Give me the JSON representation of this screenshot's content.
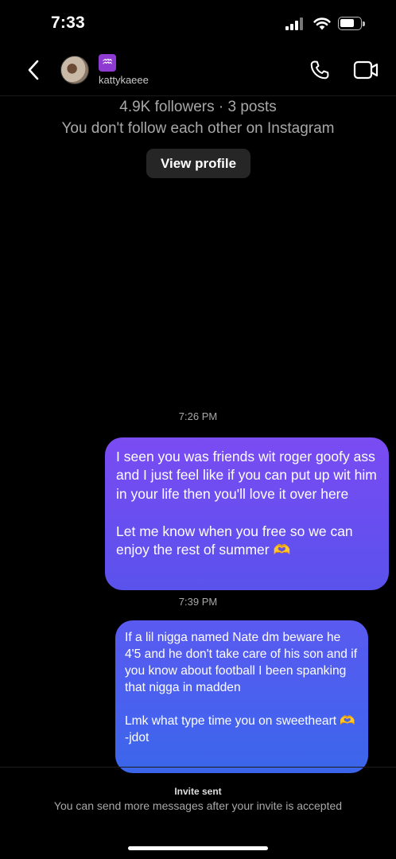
{
  "status_bar": {
    "time": "7:33"
  },
  "header": {
    "zodiac_badge": "♒",
    "username": "kattykaeee"
  },
  "profile_info": {
    "followers_text": "4.9K followers · 3 posts",
    "follow_status": "You don't follow each other on Instagram",
    "view_profile_label": "View profile"
  },
  "messages": [
    {
      "timestamp": "7:26 PM",
      "text": "I seen you was friends wit roger goofy ass and I just feel like if you can put up wit him in your life then you'll love it over here\n\nLet me know when you free so we can enjoy the rest of summer 🫶"
    },
    {
      "timestamp": "7:39 PM",
      "text": "If a lil nigga named Nate dm beware he 4'5 and he don't take care of his son and if you know about football I been spanking that nigga in madden\n\nLmk what type time you on sweetheart 🫶\n-jdot"
    }
  ],
  "footer": {
    "invite_status": "Invite sent",
    "info": "You can send more messages after your invite is accepted"
  },
  "colors": {
    "background": "#000000",
    "bubble_1": "#6a4ef0",
    "bubble_2": "#4a60ef",
    "secondary_text": "#a8a8a8",
    "button_bg": "#262626"
  }
}
